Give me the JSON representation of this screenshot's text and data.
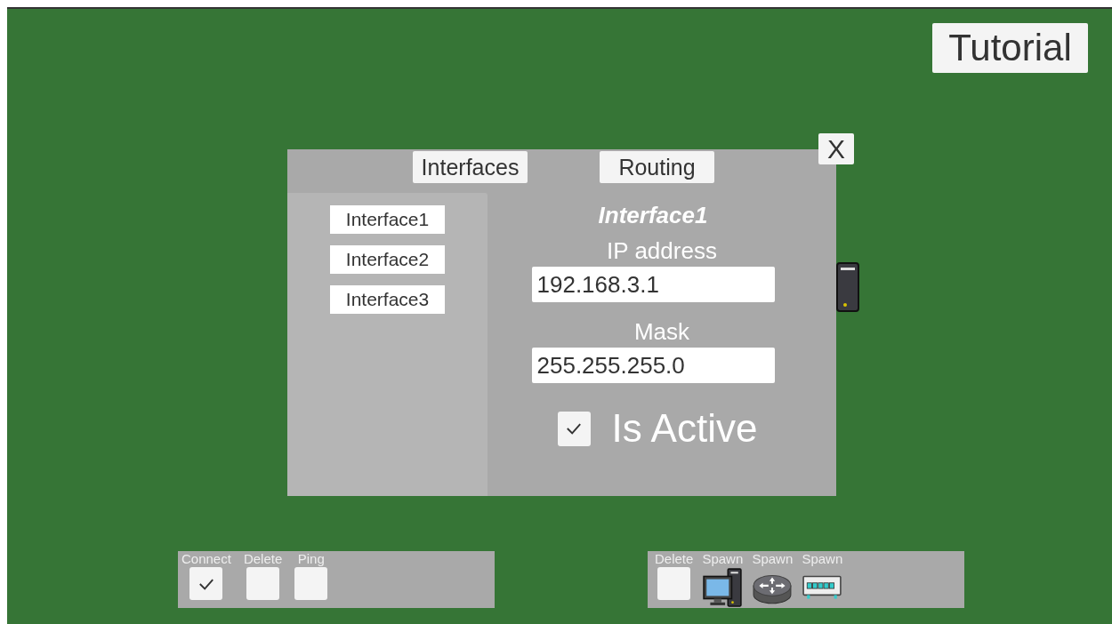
{
  "tutorial_button": "Tutorial",
  "dialog": {
    "close": "X",
    "tabs": [
      {
        "label": "Interfaces"
      },
      {
        "label": "Routing"
      }
    ],
    "interfaces": [
      "Interface1",
      "Interface2",
      "Interface3"
    ],
    "heading": "Interface1",
    "ip_label": "IP address",
    "ip_value": "192.168.3.1",
    "mask_label": "Mask",
    "mask_value": "255.255.255.0",
    "active": {
      "label": "Is Active",
      "checked": true
    }
  },
  "tool_bar": [
    {
      "label": "Connect",
      "checked": true
    },
    {
      "label": "Delete",
      "checked": false
    },
    {
      "label": "Ping",
      "checked": false
    }
  ],
  "spawn_bar": [
    {
      "kind": "checkbox",
      "label": "Delete",
      "checked": false
    },
    {
      "kind": "computer",
      "label": "Spawn"
    },
    {
      "kind": "router",
      "label": "Spawn"
    },
    {
      "kind": "switch",
      "label": "Spawn"
    }
  ]
}
